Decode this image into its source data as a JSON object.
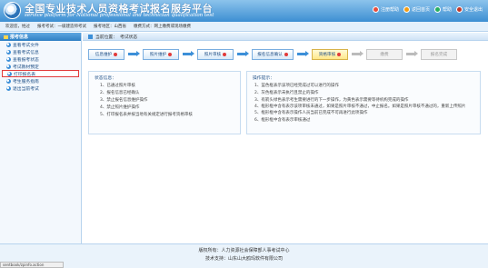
{
  "header": {
    "title": "全国专业技术人员资格考试报名服务平台",
    "subtitle": "service platform for National professional and technician qualification test",
    "links": [
      {
        "label": "注册帮助",
        "icon": "help-icon",
        "color": "#e74c3c"
      },
      {
        "label": "返回首页",
        "icon": "home-icon",
        "color": "#f39c12"
      },
      {
        "label": "帮助",
        "icon": "question-icon",
        "color": "#27ae60"
      },
      {
        "label": "安全退出",
        "icon": "exit-icon",
        "color": "#c0392b"
      }
    ]
  },
  "infobar": {
    "welcome": "欢迎您，姓过",
    "exam": "报考考试：一级建造师考试",
    "region": "报考地区：山西省",
    "method": "缴费方式：网上缴费或现场缴费"
  },
  "sidebar": {
    "heading": "报考信息",
    "items": [
      {
        "label": "查看考试文件",
        "active": false
      },
      {
        "label": "查看考试信息",
        "active": false
      },
      {
        "label": "查看报考状态",
        "active": false
      },
      {
        "label": "考试教材预定",
        "active": false
      },
      {
        "label": "打印报名表",
        "active": true
      },
      {
        "label": "考生服务指南",
        "active": false
      },
      {
        "label": "退出当前考试",
        "active": false
      }
    ]
  },
  "main": {
    "crumb_prefix": "当前位置：",
    "crumb_value": "考试状态",
    "steps": [
      {
        "label": "信息维护",
        "state": "done",
        "mark_color": "#e23b3b"
      },
      {
        "label": "照片维护",
        "state": "done",
        "mark_color": "#e23b3b"
      },
      {
        "label": "照片审核",
        "state": "done",
        "mark_color": "#e23b3b"
      },
      {
        "label": "报名信息确认",
        "state": "done",
        "mark_color": "#e23b3b"
      },
      {
        "label": "资格审核",
        "state": "current",
        "mark_color": "#e23b3b"
      },
      {
        "label": "缴费",
        "state": "future",
        "mark_color": ""
      },
      {
        "label": "报名完成",
        "state": "future",
        "mark_color": ""
      }
    ],
    "status_panel": {
      "title": "状态信息：",
      "items": [
        "1、已通过照片审核",
        "2、报名信息已经确认",
        "3、禁止报名信息维护操作",
        "4、禁止照片维护操作",
        "5、打印报名表并按当地有关规定进行报考资格审核"
      ]
    },
    "hint_panel": {
      "title": "操作提示：",
      "items": [
        {
          "text": "1、蓝色框表示该项已经完成过可以进行的操作",
          "mark": ""
        },
        {
          "text": "2、灰色框表示未执行且禁止的操作",
          "mark": ""
        },
        {
          "text": "3、有箭头绿色表示考生需要进行的下一步操作，为黄色表示需要等待机构完成的操作",
          "mark": "#3c8fd8"
        },
        {
          "text": "4、框形框中含有表示该项审核未通过，如果是照片审核不通过，中止报名。如果是照片审核不通过的，重新上传照片",
          "mark": "#e23b3b"
        },
        {
          "text": "5、框形框中含有表示操作人员当前已完成不可再进行此项操作",
          "mark": "#e23b3b"
        },
        {
          "text": "6、框形框中含有表示审核通过",
          "mark": "#2eaa4a"
        }
      ]
    }
  },
  "footer": {
    "line1": "版权所有：人力资源社会保障部人事考试中心",
    "line2": "技术支持：山东山大鸥玛软件有限公司"
  },
  "statusbar": {
    "url": "sentbook/zpinfo.action"
  }
}
